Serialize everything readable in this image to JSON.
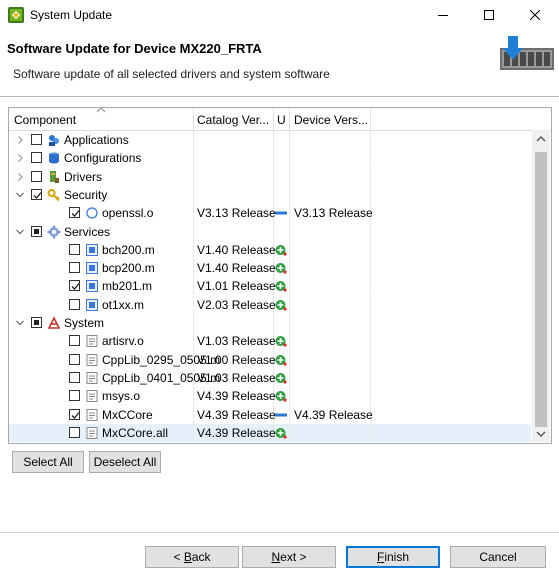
{
  "window": {
    "title": "System Update",
    "minimize_glyph": "—",
    "maximize_glyph": "☐",
    "close_glyph": "✕"
  },
  "header": {
    "title": "Software Update for Device MX220_FRTA",
    "subtitle": "Software update of all selected drivers and system software"
  },
  "tree": {
    "columns": [
      "Component",
      "Catalog Ver...",
      "U",
      "Device Vers..."
    ],
    "rows": [
      {
        "label": "Applications",
        "level": 0,
        "expander": "collapsed",
        "check": "off",
        "icon": "folder-apps-icon",
        "catalog": "",
        "update": "",
        "device": ""
      },
      {
        "label": "Configurations",
        "level": 0,
        "expander": "collapsed",
        "check": "off",
        "icon": "database-icon",
        "catalog": "",
        "update": "",
        "device": ""
      },
      {
        "label": "Drivers",
        "level": 0,
        "expander": "collapsed",
        "check": "off",
        "icon": "driver-icon",
        "catalog": "",
        "update": "",
        "device": ""
      },
      {
        "label": "Security",
        "level": 0,
        "expander": "expanded",
        "check": "on",
        "icon": "key-icon",
        "catalog": "",
        "update": "",
        "device": ""
      },
      {
        "label": "openssl.o",
        "level": 1,
        "expander": "none",
        "check": "on",
        "icon": "circle-icon",
        "catalog": "V3.13 Release",
        "update": "same",
        "device": "V3.13 Release"
      },
      {
        "label": "Services",
        "level": 0,
        "expander": "expanded",
        "check": "partial",
        "icon": "gear-icon",
        "catalog": "",
        "update": "",
        "device": ""
      },
      {
        "label": "bch200.m",
        "level": 1,
        "expander": "none",
        "check": "off",
        "icon": "module-icon",
        "catalog": "V1.40 Release",
        "update": "add",
        "device": ""
      },
      {
        "label": "bcp200.m",
        "level": 1,
        "expander": "none",
        "check": "off",
        "icon": "module-icon",
        "catalog": "V1.40 Release",
        "update": "add",
        "device": ""
      },
      {
        "label": "mb201.m",
        "level": 1,
        "expander": "none",
        "check": "on",
        "icon": "module-icon",
        "catalog": "V1.01 Release",
        "update": "add",
        "device": ""
      },
      {
        "label": "ot1xx.m",
        "level": 1,
        "expander": "none",
        "check": "off",
        "icon": "module-icon",
        "catalog": "V2.03 Release",
        "update": "add",
        "device": ""
      },
      {
        "label": "System",
        "level": 0,
        "expander": "expanded",
        "check": "partial",
        "icon": "system-icon",
        "catalog": "",
        "update": "",
        "device": ""
      },
      {
        "label": "artisrv.o",
        "level": 1,
        "expander": "none",
        "check": "off",
        "icon": "file-icon",
        "catalog": "V1.03 Release",
        "update": "add",
        "device": ""
      },
      {
        "label": "CppLib_0295_0505.m",
        "level": 1,
        "expander": "none",
        "check": "off",
        "icon": "file-icon",
        "catalog": "V1.00 Release",
        "update": "add",
        "device": ""
      },
      {
        "label": "CppLib_0401_0505.m",
        "level": 1,
        "expander": "none",
        "check": "off",
        "icon": "file-icon",
        "catalog": "V1.03 Release",
        "update": "add",
        "device": ""
      },
      {
        "label": "msys.o",
        "level": 1,
        "expander": "none",
        "check": "off",
        "icon": "file-icon",
        "catalog": "V4.39 Release",
        "update": "add",
        "device": ""
      },
      {
        "label": "MxCCore",
        "level": 1,
        "expander": "none",
        "check": "on",
        "icon": "file-icon",
        "catalog": "V4.39 Release",
        "update": "same",
        "device": "V4.39 Release"
      },
      {
        "label": "MxCCore.all",
        "level": 1,
        "expander": "none",
        "check": "off",
        "icon": "file-icon",
        "catalog": "V4.39 Release",
        "update": "add",
        "device": "",
        "selected": true
      }
    ]
  },
  "buttons": {
    "select_all": "Select All",
    "deselect_all": "Deselect All",
    "back_prefix": "< ",
    "back_key": "B",
    "back_rest": "ack",
    "next_key": "N",
    "next_rest": "ext >",
    "finish_key": "F",
    "finish_rest": "inish",
    "cancel": "Cancel"
  },
  "colors": {
    "accent": "#0078d7",
    "selection": "#e5f0fb",
    "update_add": "#2e9e3e",
    "update_same": "#2b7bd6"
  }
}
